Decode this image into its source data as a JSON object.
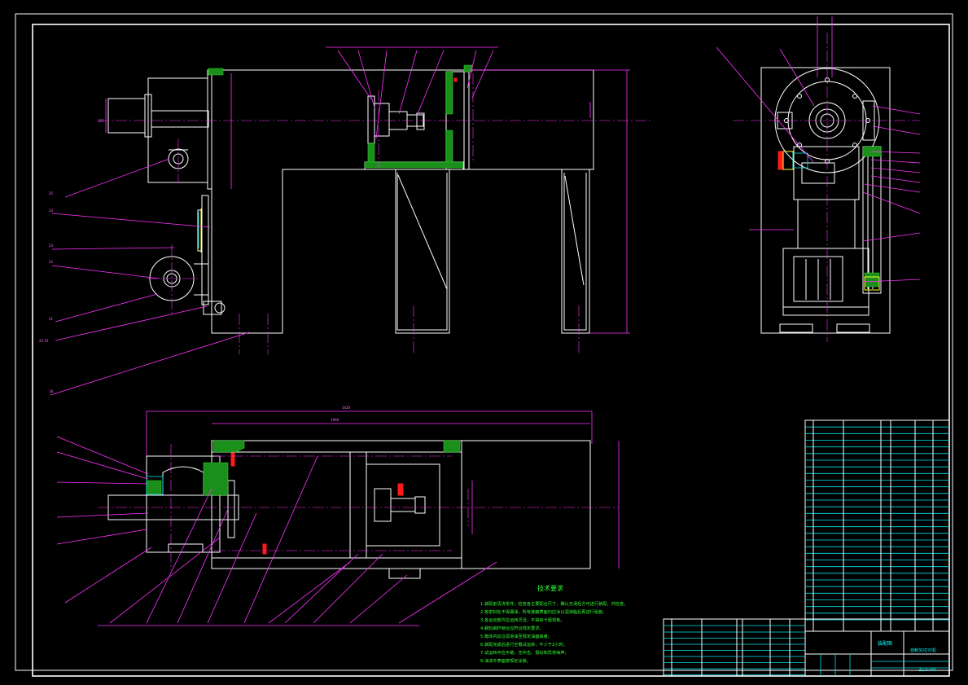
{
  "drawing": {
    "tech_notes_title": "技术要求",
    "tech_notes": [
      "1.装配前清洗零件，检查各主要配合尺寸，确认无误后方可进行装配，并检查。",
      "2.各密封处不得漏油，所有接触表面均应涂以润滑脂后再进行组装。",
      "3.各运动部件应运转灵活，不得有卡阻现象。",
      "4.蜗轮蜗杆啮合应符合规定要求。",
      "5.箱体内加注润滑油至规定油面高度。",
      "6.装配完成后进行空载试运转，不少于2小时。",
      "7.试运转中应平稳，无冲击、振动和异常噪声。",
      "8.油漆外表面按规定涂装。"
    ],
    "title_block": {
      "drawing_name": "装配图",
      "drawing_code": "ZLG-00",
      "company": "自制3D打印机"
    }
  }
}
